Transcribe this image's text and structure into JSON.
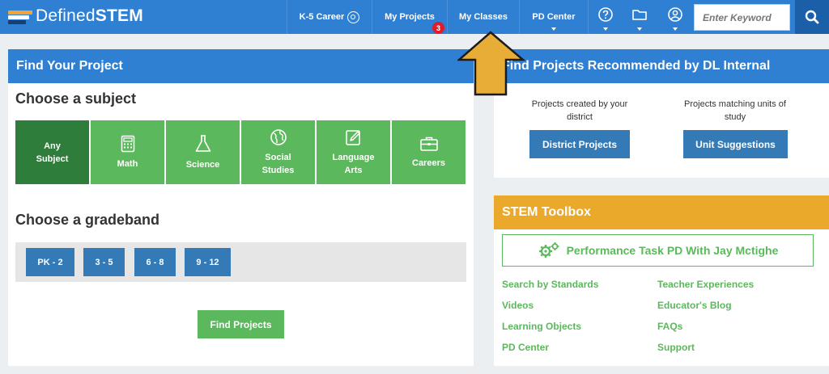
{
  "brand": {
    "name_light": "Defined",
    "name_bold": "STEM"
  },
  "nav": {
    "k5_career": "K-5 Career",
    "my_projects": "My Projects",
    "my_projects_badge": "3",
    "my_classes": "My Classes",
    "pd_center": "PD Center"
  },
  "search": {
    "placeholder": "Enter Keyword"
  },
  "find_project": {
    "title": "Find Your Project",
    "choose_subject": "Choose a subject",
    "subjects": [
      {
        "line1": "Any",
        "line2": "Subject",
        "icon": "none",
        "selected": true
      },
      {
        "line1": "Math",
        "line2": "",
        "icon": "calculator-icon",
        "selected": false
      },
      {
        "line1": "Science",
        "line2": "",
        "icon": "flask-icon",
        "selected": false
      },
      {
        "line1": "Social",
        "line2": "Studies",
        "icon": "globe-icon",
        "selected": false
      },
      {
        "line1": "Language",
        "line2": "Arts",
        "icon": "pencil-square-icon",
        "selected": false
      },
      {
        "line1": "Careers",
        "line2": "",
        "icon": "briefcase-icon",
        "selected": false
      }
    ],
    "choose_gradeband": "Choose a gradeband",
    "gradebands": [
      "PK - 2",
      "3 - 5",
      "6 - 8",
      "9 - 12"
    ],
    "find_button": "Find Projects"
  },
  "recommended": {
    "title": "Find Projects Recommended by DL Internal",
    "district_text": "Projects created by your district",
    "district_button": "District Projects",
    "units_text": "Projects matching units of study",
    "units_button": "Unit Suggestions"
  },
  "toolbox": {
    "title": "STEM Toolbox",
    "perf_button": "Performance Task PD With Jay Mctighe",
    "links_left": [
      "Search by Standards",
      "Videos",
      "Learning Objects",
      "PD Center"
    ],
    "links_right": [
      "Teacher Experiences",
      "Educator's Blog",
      "FAQs",
      "Support"
    ]
  },
  "colors": {
    "nav_blue": "#2f7fd3",
    "green": "#5cb85c",
    "dark_green": "#2f7d3a",
    "button_blue": "#337ab7",
    "toolbox_orange": "#eaa92a",
    "arrow_yellow": "#e8ad36",
    "badge_red": "#e01b2a"
  }
}
